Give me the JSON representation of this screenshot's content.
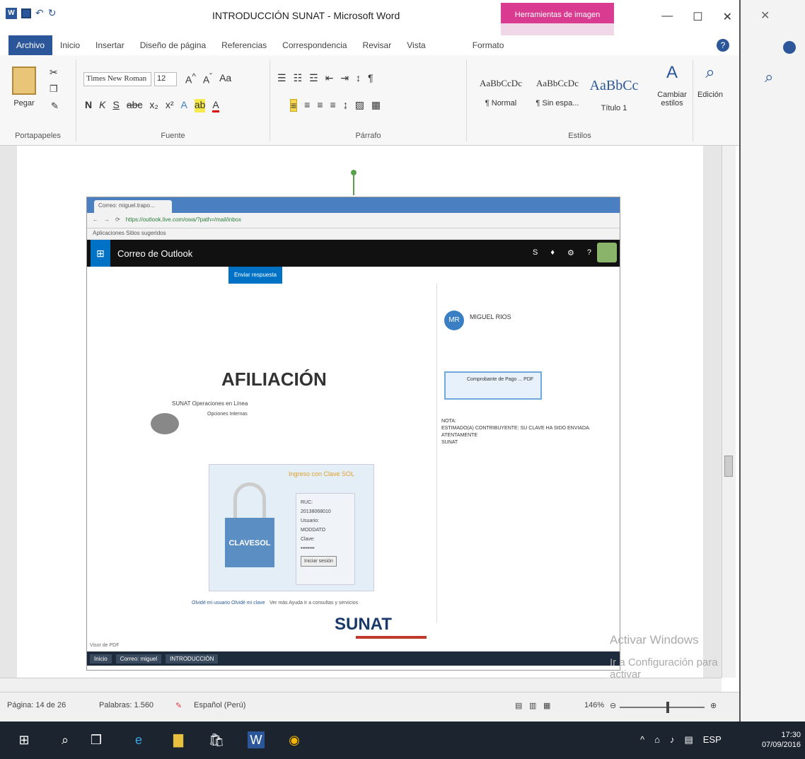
{
  "word": {
    "title": "INTRODUCCIÓN SUNAT - Microsoft Word",
    "context_tab_header": "Herramientas de imagen",
    "tabs": [
      "Archivo",
      "Inicio",
      "Insertar",
      "Diseño de página",
      "Referencias",
      "Correspondencia",
      "Revisar",
      "Vista",
      "Formato"
    ],
    "ribbon": {
      "paste_label": "Pegar",
      "clipboard_group": "Portapapeles",
      "font_name": "Times New Roman",
      "font_size": "12",
      "font_group": "Fuente",
      "paragraph_group": "Párrafo",
      "styles_group": "Estilos",
      "styles": [
        {
          "sample": "AaBbCcDc",
          "name": "¶ Normal"
        },
        {
          "sample": "AaBbCcDc",
          "name": "¶ Sin espa..."
        },
        {
          "sample": "AaBbCc",
          "name": "Título 1"
        }
      ],
      "change_styles": "Cambiar estilos",
      "edit": "Edición"
    },
    "status": {
      "page": "Página: 14 de 26",
      "words": "Palabras: 1.560",
      "language": "Español (Perú)",
      "zoom": "146%"
    }
  },
  "embedded": {
    "browser_tab": "Correo: miguel.trapo...",
    "url": "https://outlook.live.com/owa/?path=/mail/inbox",
    "bookmarks": "Aplicaciones   Sitios sugeridos",
    "app_title": "Correo de Outlook",
    "reply_label": "Enviar respuesta",
    "afiliacion": "AFILIACIÓN",
    "sunat_ops": "SUNAT Operaciones en Línea",
    "sunat_ops_sub": "Opciones Internas",
    "login_title": "Ingreso con Clave SOL",
    "login_fields": [
      "RUC:",
      "20138068010",
      "Usuario:",
      "MODDATO",
      "Clave:",
      "••••••••"
    ],
    "login_button": "Iniciar sesión",
    "links_left": "Olvidé mi usuario   Olvidé mi clave",
    "links_right": "Ver más     Ayuda    Ir a consultas y servicios",
    "sunat_logo": "SUNAT",
    "from_name": "MIGUEL RIOS",
    "from_initials": "MR",
    "attachment": "Comprobante de Pago ... PDF",
    "message": "NOTA:\nESTIMADO(A) CONTRIBUYENTE: SU CLAVE HA SIDO ENVIADA.\nATENTAMENTE\nSUNAT",
    "footer": "Visor de PDF",
    "taskbar": [
      "Inicio",
      "Correo: miguel",
      "INTRODUCCIÓN"
    ]
  },
  "watermark": {
    "line1": "Activar Windows",
    "line2": "Ir a Configuración para activar"
  },
  "taskbar": {
    "time": "17:30",
    "date": "07/09/2016",
    "lang": "ESP"
  }
}
